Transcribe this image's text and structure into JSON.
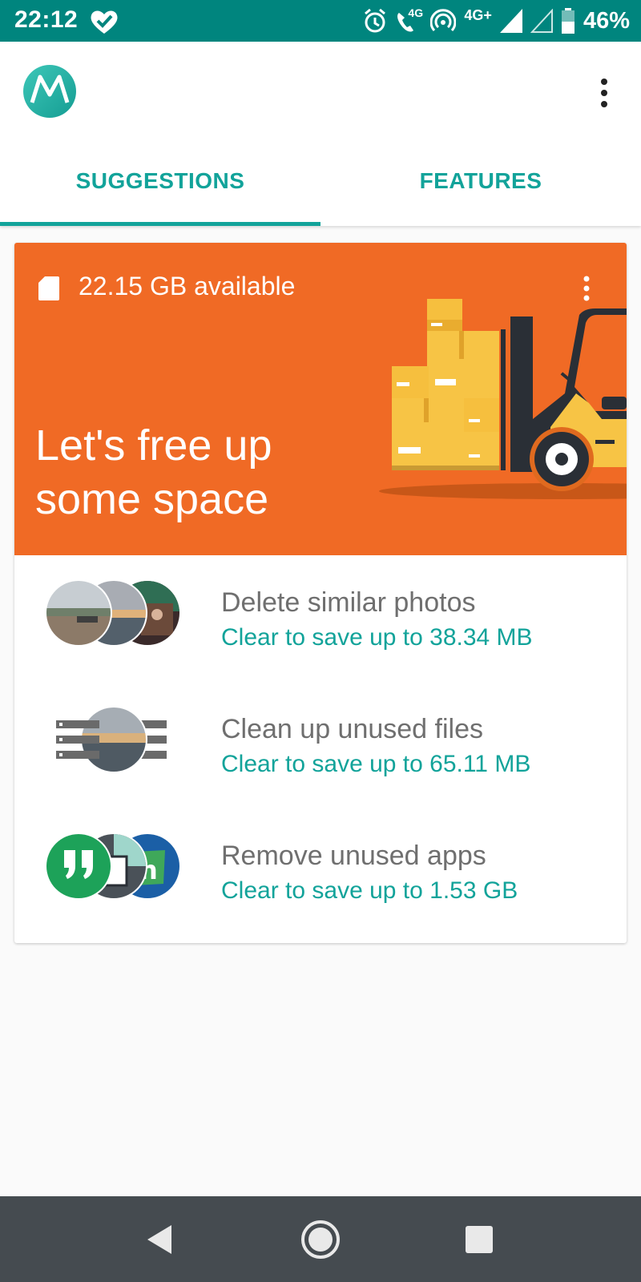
{
  "status_bar": {
    "time": "22:12",
    "network": "4G+",
    "call_badge": "4G",
    "battery": "46%"
  },
  "tabs": [
    {
      "label": "SUGGESTIONS",
      "selected": true
    },
    {
      "label": "FEATURES",
      "selected": false
    }
  ],
  "hero": {
    "storage_available": "22.15 GB available",
    "headline": "Let's free up some space",
    "background_color": "#f06a25"
  },
  "suggestions": [
    {
      "title": "Delete similar photos",
      "subtitle": "Clear to save up to 38.34 MB",
      "icon": "similar-photos-icon"
    },
    {
      "title": "Clean up unused files",
      "subtitle": "Clear to save up to 65.11 MB",
      "icon": "unused-files-icon"
    },
    {
      "title": "Remove unused apps",
      "subtitle": "Clear to save up to 1.53 GB",
      "icon": "unused-apps-icon"
    }
  ],
  "colors": {
    "accent": "#12a39a",
    "status_bar": "#00857e",
    "nav_bar": "#454b50"
  },
  "nav_bar": [
    "back-icon",
    "home-icon",
    "recents-icon"
  ]
}
